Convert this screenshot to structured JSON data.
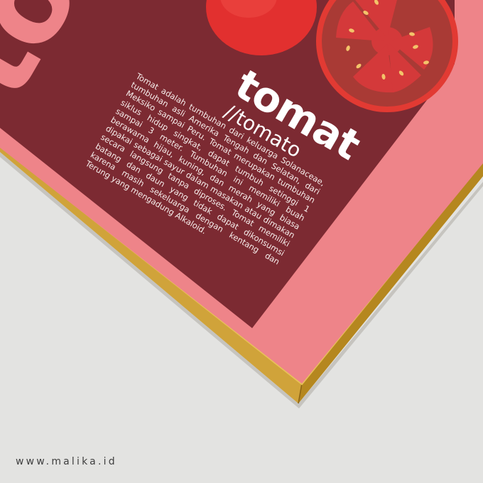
{
  "poster": {
    "giant_letters": "tom",
    "title": "tomat",
    "subtitle": "//tomato",
    "description": "Tomat adalah tumbuhan dari keluarga Solanaceae, tumbuhan asli Amerika Tengah dan Selatan, dari Meksiko sampai Peru. Tomat merupakan tumbuhan siklus hidup singkat, dapat tumbuh setinggi 1 sampai 3 meter. Tumbuhan ini memiliki buah berawarna hijau, kuning, dan merah yang biasa dipakai sebagai sayur dalam masakan atau dimakan secara langsung tanpa diproses. Tomat memiliki batang dan daun yang tidak dapat dikonsumsi karena masih sekeluarga dengan kentang dan Terung yang mengadung Alkaloid."
  },
  "footer": {
    "website": "www.malika.id"
  },
  "colors": {
    "wall": "#e3e3e1",
    "poster_pink": "#ee8489",
    "poster_maroon": "#7c2a32",
    "tomato_red": "#e2302f",
    "tomato_dark": "#9e2e2e",
    "seed_yellow": "#f3c46a",
    "frame_wood": "#c89a2c"
  },
  "icons": {
    "whole_tomato": "tomato-whole-illustration",
    "sliced_tomato": "tomato-slice-illustration"
  }
}
